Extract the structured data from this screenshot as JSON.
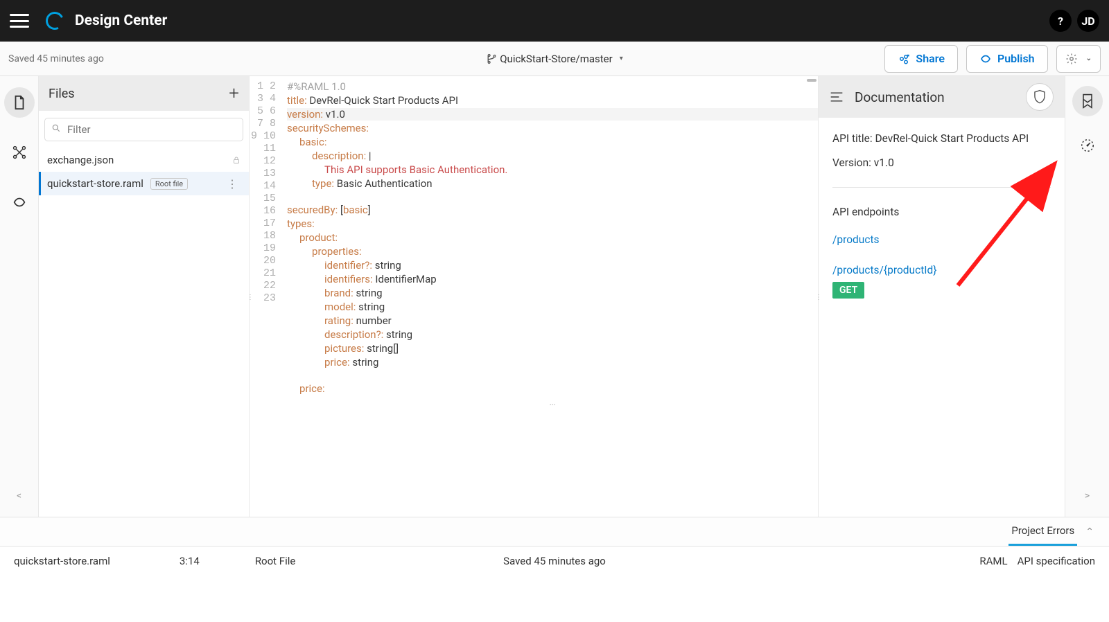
{
  "header": {
    "app_title": "Design Center",
    "user_initials": "JD"
  },
  "subbar": {
    "saved": "Saved 45 minutes ago",
    "branch": "QuickStart-Store/master",
    "share": "Share",
    "publish": "Publish"
  },
  "files": {
    "title": "Files",
    "filter_placeholder": "Filter",
    "items": [
      {
        "name": "exchange.json",
        "locked": true,
        "active": false
      },
      {
        "name": "quickstart-store.raml",
        "locked": false,
        "active": true,
        "root_badge": "Root file"
      }
    ]
  },
  "editor": {
    "line_count": 23,
    "raml": {
      "header": "#%RAML 1.0",
      "title_key": "title:",
      "title_val": " DevRel-Quick Start Products API",
      "version_key": "version:",
      "version_val": " v1.0",
      "securitySchemes_key": "securitySchemes:",
      "basic_key": "basic:",
      "description_key": "description:",
      "description_pipe": " |",
      "description_text": "This API supports Basic Authentication.",
      "type_key": "type:",
      "type_val": " Basic Authentication",
      "securedBy_key": "securedBy:",
      "securedBy_open": " [",
      "securedBy_val": "basic",
      "securedBy_close": "]",
      "types_key": "types:",
      "product_key": "product:",
      "properties_key": "properties:",
      "identifier_key": "identifier?:",
      "string_t": " string",
      "identifiers_key": "identifiers:",
      "identifiers_val": " IdentifierMap",
      "brand_key": "brand:",
      "model_key": "model:",
      "rating_key": "rating:",
      "number_t": " number",
      "description2_key": "description?:",
      "pictures_key": "pictures:",
      "pictures_val": " string[]",
      "price_key": "price:",
      "price2_key": "price:"
    }
  },
  "doc": {
    "title": "Documentation",
    "api_title": "API title: DevRel-Quick Start Products API",
    "version": "Version: v1.0",
    "endpoints_heading": "API endpoints",
    "endpoints": [
      {
        "path": "/products"
      },
      {
        "path": "/products/{productId}",
        "method": "GET"
      }
    ]
  },
  "errors_bar": {
    "label": "Project Errors"
  },
  "status": {
    "file": "quickstart-store.raml",
    "cursor": "3:14",
    "root": "Root File",
    "saved": "Saved 45 minutes ago",
    "lang": "RAML",
    "spec": "API specification"
  }
}
